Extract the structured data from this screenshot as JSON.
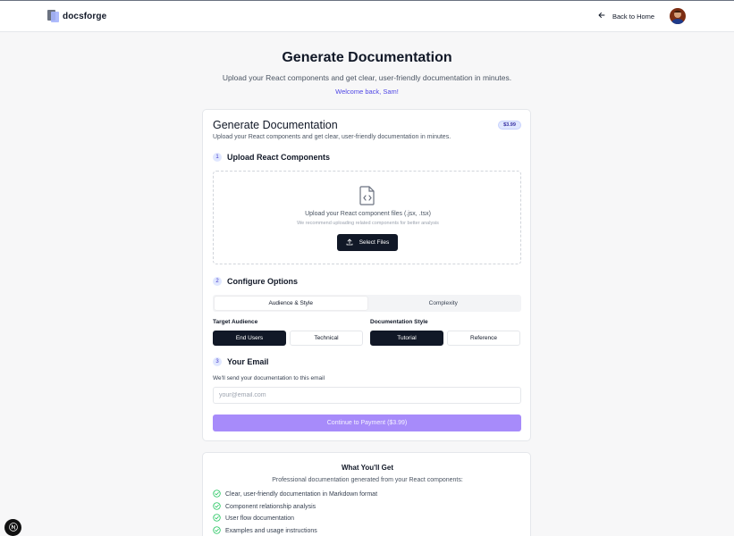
{
  "header": {
    "brand": "docsforge",
    "back_label": "Back to Home"
  },
  "hero": {
    "title": "Generate Documentation",
    "subtitle": "Upload your React components and get clear, user-friendly documentation in minutes.",
    "welcome": "Welcome back, Sam!"
  },
  "card": {
    "title": "Generate Documentation",
    "subtitle": "Upload your React components and get clear, user-friendly documentation in minutes.",
    "price": "$3.99"
  },
  "step1": {
    "number": "1",
    "title": "Upload React Components",
    "drop_title": "Upload your React component files (.jsx, .tsx)",
    "drop_hint": "We recommend uploading related components for better analysis",
    "select_label": "Select Files"
  },
  "step2": {
    "number": "2",
    "title": "Configure Options",
    "tabs": [
      {
        "label": "Audience & Style",
        "active": true
      },
      {
        "label": "Complexity",
        "active": false
      }
    ],
    "audience": {
      "label": "Target Audience",
      "options": [
        "End Users",
        "Technical"
      ],
      "selected": "End Users"
    },
    "style": {
      "label": "Documentation Style",
      "options": [
        "Tutorial",
        "Reference"
      ],
      "selected": "Tutorial"
    }
  },
  "step3": {
    "number": "3",
    "title": "Your Email",
    "hint": "We'll send your documentation to this email",
    "placeholder": "your@email.com",
    "value": ""
  },
  "pay_button": "Continue to Payment ($3.99)",
  "what_you_get": {
    "title": "What You'll Get",
    "subtitle": "Professional documentation generated from your React components:",
    "items": [
      "Clear, user-friendly documentation in Markdown format",
      "Component relationship analysis",
      "User flow documentation",
      "Examples and usage instructions"
    ]
  },
  "colors": {
    "primary_dark": "#111827",
    "accent": "#4f46e5",
    "button_purple": "#a78bfa",
    "check_green": "#22c55e"
  },
  "icons": {
    "logo": "docs-logo-icon",
    "back": "arrow-left-icon",
    "file": "file-code-icon",
    "upload": "upload-icon",
    "check": "check-circle-icon",
    "nextjs": "nextjs-n-icon"
  }
}
